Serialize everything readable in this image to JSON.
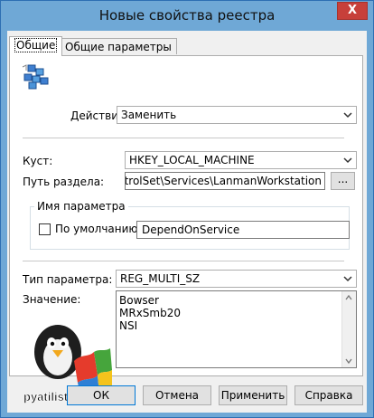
{
  "window": {
    "title": "Новые свойства реестра",
    "close_glyph": "X"
  },
  "tabs": [
    {
      "label": "Общие",
      "active": true
    },
    {
      "label": "Общие параметры",
      "active": false
    }
  ],
  "action": {
    "label": "Действие:",
    "value": "Заменить"
  },
  "hive": {
    "label": "Куст:",
    "value": "HKEY_LOCAL_MACHINE"
  },
  "key_path": {
    "label": "Путь раздела:",
    "value": "entControlSet\\Services\\LanmanWorkstation",
    "browse_label": "..."
  },
  "value_name_group": {
    "title": "Имя параметра",
    "default_label": "По умолчанию",
    "default_checked": false,
    "value": "DependOnService"
  },
  "value_type": {
    "label": "Тип параметра:",
    "value": "REG_MULTI_SZ"
  },
  "value_data": {
    "label": "Значение:",
    "lines": [
      "Bowser",
      "MRxSmb20",
      "NSI"
    ]
  },
  "watermark": {
    "text": "pyatilistnik.org"
  },
  "buttons": {
    "ok": "ОК",
    "cancel": "Отмена",
    "apply": "Применить",
    "help": "Справка"
  },
  "colors": {
    "titlebar": "#6fa8d6",
    "close": "#c7403a",
    "default_button_border": "#0078d7"
  }
}
